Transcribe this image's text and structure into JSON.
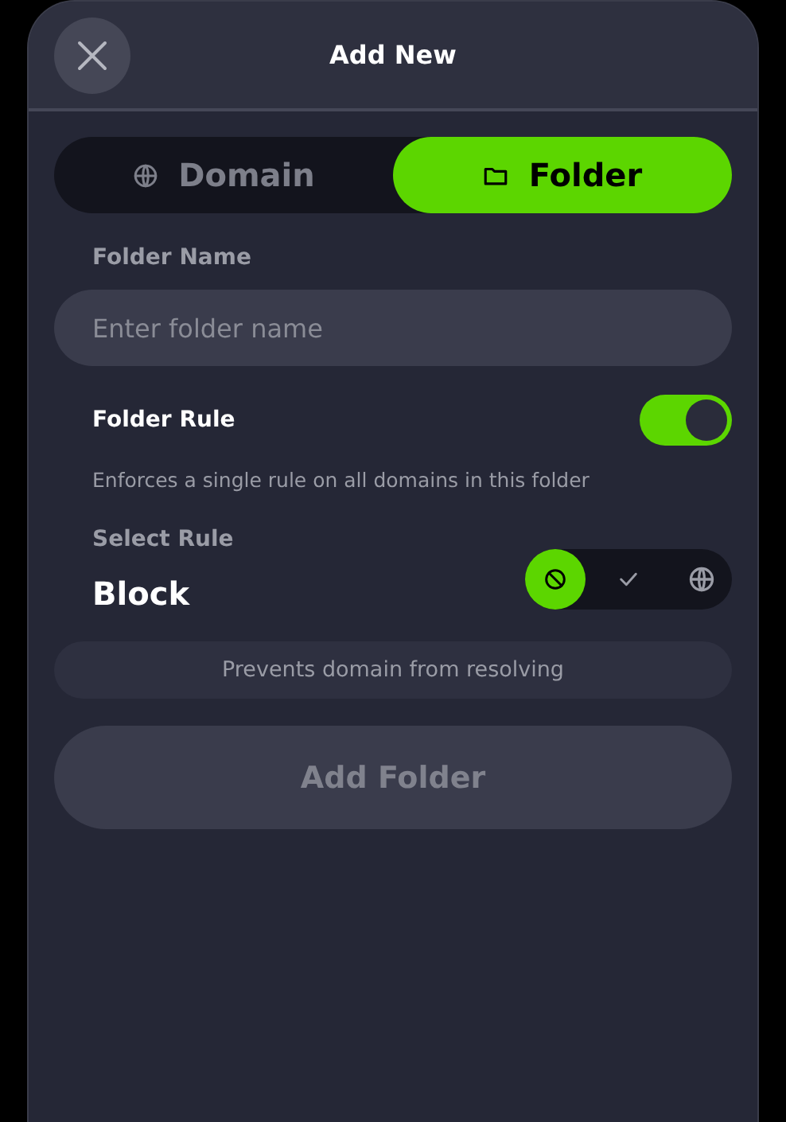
{
  "header": {
    "title": "Add New"
  },
  "tabs": [
    {
      "kind": "globe",
      "label": "Domain",
      "selected": false
    },
    {
      "kind": "folder",
      "label": "Folder",
      "selected": true
    }
  ],
  "folder_name": {
    "label": "Folder Name",
    "placeholder": "Enter folder name"
  },
  "folder_rule": {
    "label": "Folder Rule",
    "on": true,
    "description": "Enforces a single rule on all domains in this folder"
  },
  "select_rule": {
    "label": "Select Rule",
    "value": "Block",
    "options": [
      {
        "kind": "block",
        "selected": true
      },
      {
        "kind": "check",
        "selected": false
      },
      {
        "kind": "globe",
        "selected": false
      }
    ],
    "info": "Prevents domain from resolving"
  },
  "add_button": {
    "label": "Add Folder",
    "disabled": true
  }
}
